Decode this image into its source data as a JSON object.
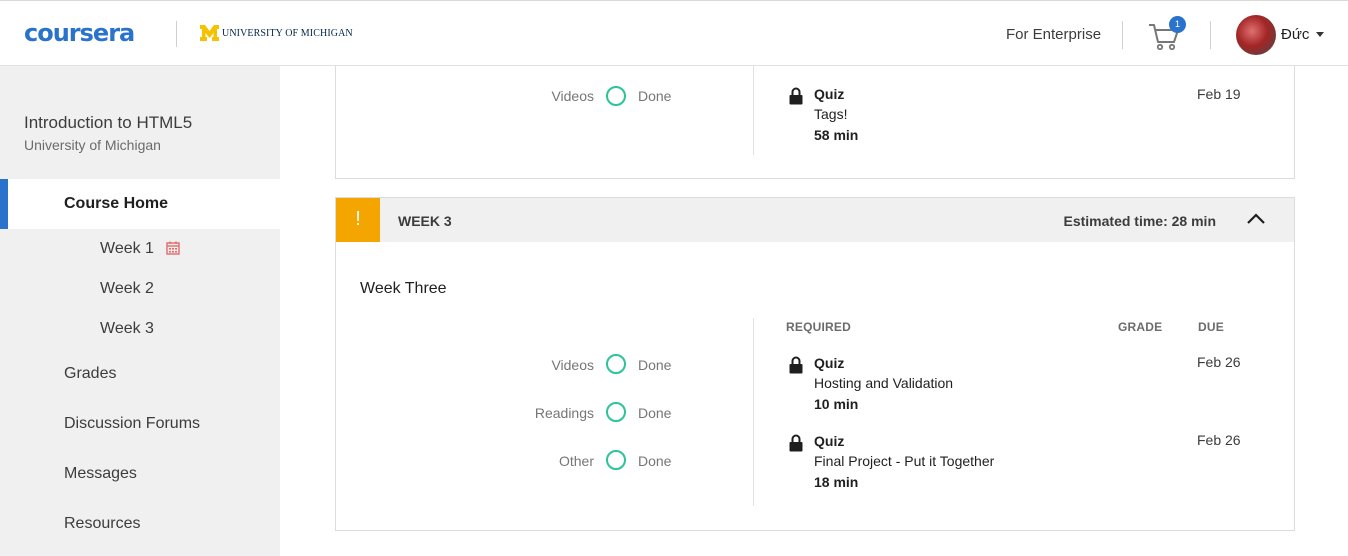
{
  "header": {
    "logo_text": "coursera",
    "partner_text": "UNIVERSITY OF MICHIGAN",
    "enterprise_label": "For Enterprise",
    "cart_count": "1",
    "username": "Đức"
  },
  "sidebar": {
    "course_title": "Introduction to HTML5",
    "course_university": "University of Michigan",
    "home_label": "Course Home",
    "weeks": [
      {
        "label": "Week 1"
      },
      {
        "label": "Week 2"
      },
      {
        "label": "Week 3"
      }
    ],
    "items": [
      {
        "label": "Grades"
      },
      {
        "label": "Discussion Forums"
      },
      {
        "label": "Messages"
      },
      {
        "label": "Resources"
      }
    ]
  },
  "week2_partial": {
    "stats": [
      {
        "label": "Videos",
        "status": "Done"
      }
    ],
    "items": [
      {
        "type": "Quiz",
        "name": "Tags!",
        "time": "58 min",
        "due": "Feb 19"
      }
    ]
  },
  "week3": {
    "flag": "!",
    "title": "WEEK 3",
    "estimated": "Estimated time: 28 min",
    "name": "Week Three",
    "columns": {
      "required": "REQUIRED",
      "grade": "GRADE",
      "due": "DUE"
    },
    "stats": [
      {
        "label": "Videos",
        "status": "Done"
      },
      {
        "label": "Readings",
        "status": "Done"
      },
      {
        "label": "Other",
        "status": "Done"
      }
    ],
    "items": [
      {
        "type": "Quiz",
        "name": "Hosting and Validation",
        "time": "10 min",
        "due": "Feb 26"
      },
      {
        "type": "Quiz",
        "name": "Final Project - Put it Together",
        "time": "18 min",
        "due": "Feb 26"
      }
    ]
  },
  "colors": {
    "brand_blue": "#2a73cc",
    "warning_orange": "#f5a500",
    "done_teal": "#2ac39a"
  }
}
